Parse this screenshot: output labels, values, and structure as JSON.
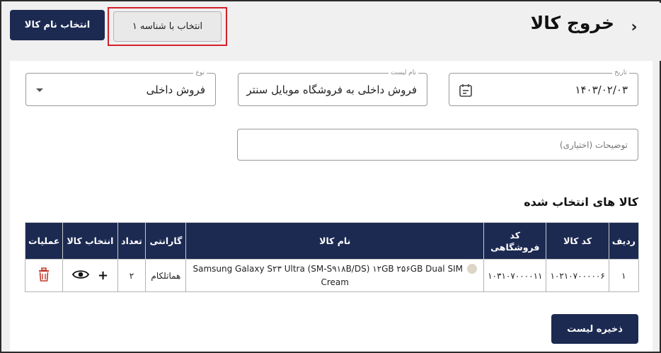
{
  "header": {
    "title": "خروج کالا",
    "select_by_name_label": "انتخاب نام کالا",
    "select_by_id_label": "انتخاب با شناسه ۱"
  },
  "form": {
    "date": {
      "label": "تاریخ",
      "value": "۱۴۰۳/۰۲/۰۳"
    },
    "list_name": {
      "label": "نام لیست",
      "value": "فروش داخلی به فروشگاه موبایل سنتر"
    },
    "type": {
      "label": "نوع",
      "value": "فروش داخلی"
    },
    "notes": {
      "placeholder": "توضیحات (اختیاری)"
    }
  },
  "selected_section": {
    "title": "کالا های انتخاب شده",
    "columns": {
      "row": "ردیف",
      "product_code": "کد کالا",
      "store_code": "کد فروشگاهی",
      "product_name": "نام کالا",
      "warranty": "گارانتی",
      "quantity": "تعداد",
      "select_product": "انتخاب کالا",
      "actions": "عملیات"
    },
    "rows": [
      {
        "row": "۱",
        "product_code": "۱۰۲۱۰۷۰۰۰۰۰۶",
        "store_code": "۱۰۳۱۰۷۰۰۰۰۱۱",
        "product_name": "Samsung Galaxy S۲۳ Ultra (SM-S۹۱۸B/DS) ۱۲GB ۲۵۶GB Dual SIM Cream",
        "warranty": "هماتلکام",
        "quantity": "۲",
        "color": "#ddd5c6"
      }
    ]
  },
  "footer": {
    "save_label": "ذخیره لیست"
  },
  "colors": {
    "primary": "#1c2a52",
    "highlight": "#d6202a",
    "delete": "#c0392b"
  }
}
